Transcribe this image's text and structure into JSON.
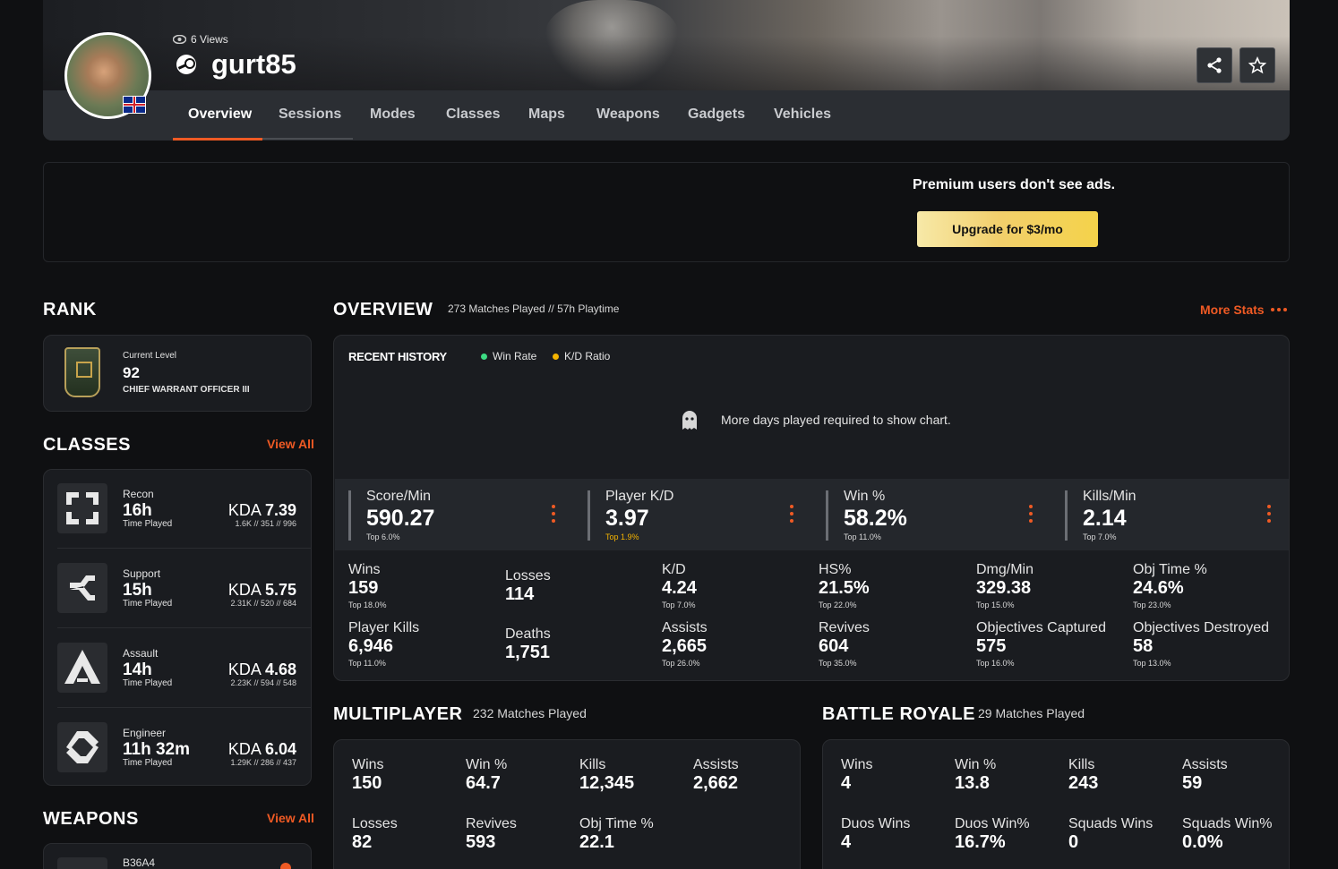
{
  "profile": {
    "views": "6 Views",
    "name": "gurt85"
  },
  "nav": {
    "tabs": [
      "Overview",
      "Sessions",
      "Modes",
      "Classes",
      "Maps",
      "Weapons",
      "Gadgets",
      "Vehicles"
    ]
  },
  "ad": {
    "text": "Premium users don't see ads.",
    "button": "Upgrade for $3/mo"
  },
  "rank": {
    "title": "RANK",
    "label": "Current Level",
    "level": "92",
    "name": "CHIEF WARRANT OFFICER III"
  },
  "classes": {
    "title": "CLASSES",
    "view_all": "View All",
    "items": [
      {
        "name": "Recon",
        "time": "16h",
        "time_label": "Time Played",
        "kda_label": "KDA",
        "kda": "7.39",
        "kda_sub": "1.6K // 351 // 996"
      },
      {
        "name": "Support",
        "time": "15h",
        "time_label": "Time Played",
        "kda_label": "KDA",
        "kda": "5.75",
        "kda_sub": "2.31K // 520 // 684"
      },
      {
        "name": "Assault",
        "time": "14h",
        "time_label": "Time Played",
        "kda_label": "KDA",
        "kda": "4.68",
        "kda_sub": "2.23K // 594 // 548"
      },
      {
        "name": "Engineer",
        "time": "11h 32m",
        "time_label": "Time Played",
        "kda_label": "KDA",
        "kda": "6.04",
        "kda_sub": "1.29K // 286 // 437"
      }
    ]
  },
  "weapons": {
    "title": "WEAPONS",
    "view_all": "View All",
    "first": "B36A4"
  },
  "overview": {
    "title": "OVERVIEW",
    "subtitle": "273 Matches Played // 57h Playtime",
    "more_stats": "More Stats",
    "recent_history": "RECENT HISTORY",
    "legend_win": "Win Rate",
    "legend_kd": "K/D Ratio",
    "empty_msg": "More days played required to show chart.",
    "top_stats": [
      {
        "label": "Score/Min",
        "value": "590.27",
        "rank": "Top 6.0%"
      },
      {
        "label": "Player K/D",
        "value": "3.97",
        "rank": "Top 1.9%"
      },
      {
        "label": "Win %",
        "value": "58.2%",
        "rank": "Top 11.0%"
      },
      {
        "label": "Kills/Min",
        "value": "2.14",
        "rank": "Top 7.0%"
      }
    ],
    "row1": [
      {
        "label": "Wins",
        "value": "159",
        "rank": "Top 18.0%"
      },
      {
        "label": "Losses",
        "value": "114",
        "rank": ""
      },
      {
        "label": "K/D",
        "value": "4.24",
        "rank": "Top 7.0%"
      },
      {
        "label": "HS%",
        "value": "21.5%",
        "rank": "Top 22.0%"
      },
      {
        "label": "Dmg/Min",
        "value": "329.38",
        "rank": "Top 15.0%"
      },
      {
        "label": "Obj Time %",
        "value": "24.6%",
        "rank": "Top 23.0%"
      }
    ],
    "row2": [
      {
        "label": "Player Kills",
        "value": "6,946",
        "rank": "Top 11.0%"
      },
      {
        "label": "Deaths",
        "value": "1,751",
        "rank": ""
      },
      {
        "label": "Assists",
        "value": "2,665",
        "rank": "Top 26.0%"
      },
      {
        "label": "Revives",
        "value": "604",
        "rank": "Top 35.0%"
      },
      {
        "label": "Objectives Captured",
        "value": "575",
        "rank": "Top 16.0%"
      },
      {
        "label": "Objectives Destroyed",
        "value": "58",
        "rank": "Top 13.0%"
      }
    ]
  },
  "multiplayer": {
    "title": "MULTIPLAYER",
    "subtitle": "232 Matches Played",
    "row1": [
      {
        "label": "Wins",
        "value": "150"
      },
      {
        "label": "Win %",
        "value": "64.7"
      },
      {
        "label": "Kills",
        "value": "12,345"
      },
      {
        "label": "Assists",
        "value": "2,662"
      }
    ],
    "row2": [
      {
        "label": "Losses",
        "value": "82"
      },
      {
        "label": "Revives",
        "value": "593"
      },
      {
        "label": "Obj Time %",
        "value": "22.1"
      }
    ]
  },
  "battle_royale": {
    "title": "BATTLE ROYALE",
    "subtitle": "29 Matches Played",
    "row1": [
      {
        "label": "Wins",
        "value": "4"
      },
      {
        "label": "Win %",
        "value": "13.8"
      },
      {
        "label": "Kills",
        "value": "243"
      },
      {
        "label": "Assists",
        "value": "59"
      }
    ],
    "row2": [
      {
        "label": "Duos Wins",
        "value": "4"
      },
      {
        "label": "Duos Win%",
        "value": "16.7%"
      },
      {
        "label": "Squads Wins",
        "value": "0"
      },
      {
        "label": "Squads Win%",
        "value": "0.0%"
      }
    ]
  },
  "colors": {
    "accent": "#ef5a24",
    "win_rate": "#3ddc84",
    "kd_ratio": "#f5b400"
  }
}
